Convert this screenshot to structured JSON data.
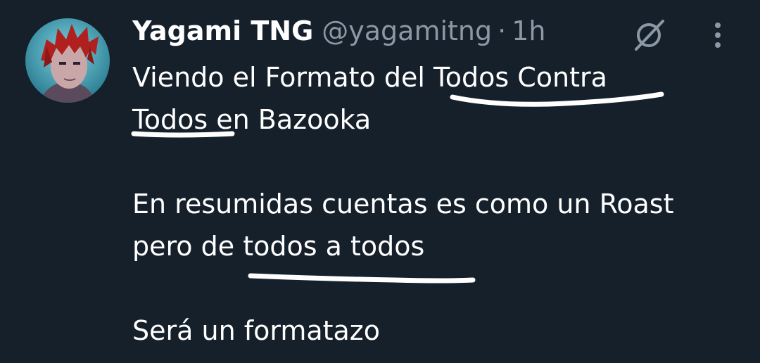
{
  "tweet": {
    "author": {
      "display_name": "Yagami TNG",
      "handle": "@yagamitng",
      "separator": "·",
      "time": "1h"
    },
    "lines": [
      "Viendo el Formato del Todos Contra",
      "Todos en Bazooka",
      "En resumidas cuentas es como un Roast",
      "pero de todos a todos",
      "Será un formatazo"
    ],
    "icons": {
      "grok": "grok-icon",
      "more": "more-vertical-icon"
    },
    "colors": {
      "background": "#15202b",
      "text": "#ffffff",
      "muted": "#8b98a5",
      "annotation": "#ffffff"
    }
  }
}
